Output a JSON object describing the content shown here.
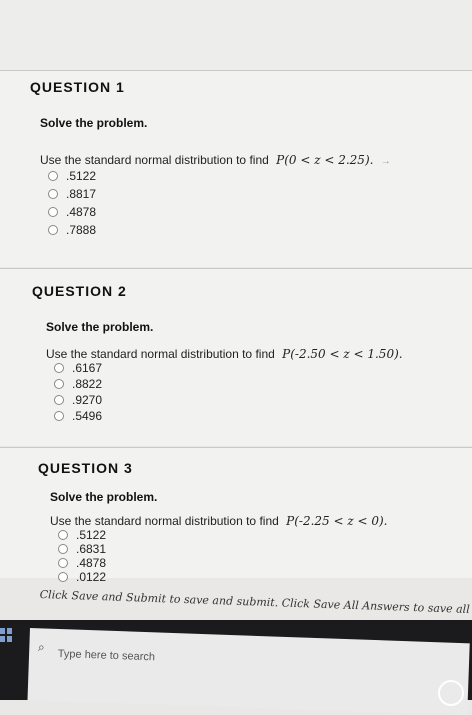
{
  "questions": [
    {
      "title": "QUESTION 1",
      "subtitle": "Solve the problem.",
      "prompt": "Use the standard normal distribution to find",
      "expr": "P(0 < z < 2.25).",
      "options": [
        ".5122",
        ".8817",
        ".4878",
        ".7888"
      ]
    },
    {
      "title": "QUESTION 2",
      "subtitle": "Solve the problem.",
      "prompt": "Use the standard normal distribution to find",
      "expr": "P(-2.50 < z < 1.50).",
      "options": [
        ".6167",
        ".8822",
        ".9270",
        ".5496"
      ]
    },
    {
      "title": "QUESTION 3",
      "subtitle": "Solve the problem.",
      "prompt": "Use the standard normal distribution to find",
      "expr": "P(-2.25 < z < 0).",
      "options": [
        ".5122",
        ".6831",
        ".4878",
        ".0122"
      ]
    }
  ],
  "footer": {
    "note": "Click Save and Submit to save and submit. Click Save All Answers to save all a"
  },
  "taskbar": {
    "search_placeholder": "Type here to search",
    "windows_icon": "windows-logo",
    "search_icon": "search-icon"
  }
}
